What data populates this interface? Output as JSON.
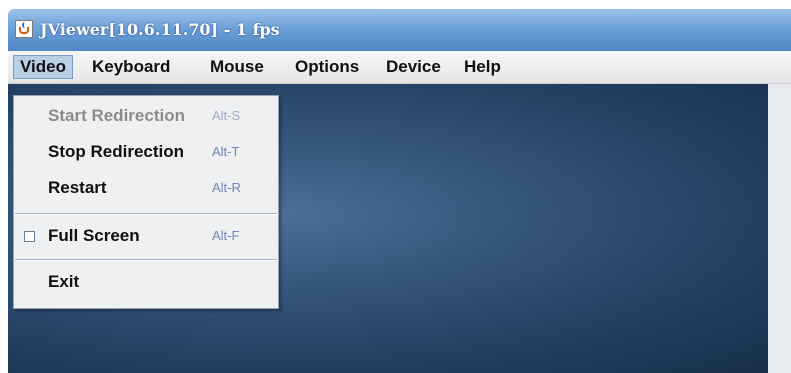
{
  "window": {
    "title": "JViewer[10.6.11.70] - 1 fps",
    "icon": "java-cup-icon"
  },
  "menubar": {
    "items": [
      {
        "label": "Video",
        "active": true
      },
      {
        "label": "Keyboard",
        "active": false
      },
      {
        "label": "Mouse",
        "active": false
      },
      {
        "label": "Options",
        "active": false
      },
      {
        "label": "Device",
        "active": false
      },
      {
        "label": "Help",
        "active": false
      }
    ]
  },
  "video_menu": {
    "items": [
      {
        "label": "Start Redirection",
        "shortcut": "Alt-S",
        "enabled": false
      },
      {
        "label": "Stop Redirection",
        "shortcut": "Alt-T",
        "enabled": true
      },
      {
        "label": "Restart",
        "shortcut": "Alt-R",
        "enabled": true
      },
      {
        "label": "Full Screen",
        "shortcut": "Alt-F",
        "enabled": true,
        "checkbox": true,
        "checked": false
      },
      {
        "label": "Exit",
        "shortcut": "",
        "enabled": true
      }
    ]
  },
  "colors": {
    "titlebar": "#6da1d8",
    "menu_highlight": "#b8cfe5",
    "desktop": "#34557a",
    "shortcut_text": "#6a86b8"
  }
}
